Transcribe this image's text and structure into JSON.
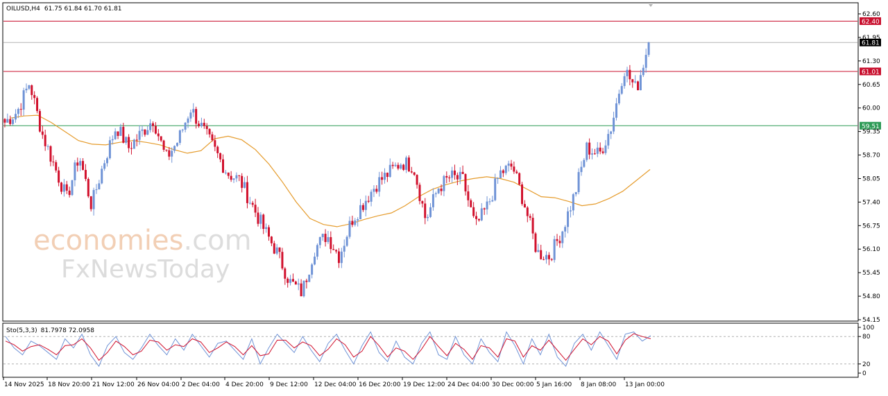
{
  "chart_data": [
    {
      "type": "candlestick",
      "title": "OILUSD,H4",
      "ohlc_header": "61.75 61.84 61.70 61.81",
      "last_price": 61.81,
      "ylim": [
        54.15,
        62.95
      ],
      "y_ticks": [
        "62.60",
        "61.95",
        "61.30",
        "60.65",
        "60.00",
        "59.35",
        "58.70",
        "58.05",
        "57.40",
        "56.75",
        "56.10",
        "55.45",
        "54.80",
        "54.15"
      ],
      "x_ticks": [
        "14 Nov 2025",
        "18 Nov 20:00",
        "21 Nov 12:00",
        "26 Nov 04:00",
        "2 Dec 04:00",
        "4 Dec 20:00",
        "9 Dec 12:00",
        "12 Dec 04:00",
        "16 Dec 20:00",
        "19 Dec 12:00",
        "24 Dec 04:00",
        "30 Dec 00:00",
        "5 Jan 16:00",
        "8 Jan 08:00",
        "13 Jan 00:00"
      ],
      "horizontal_levels": [
        {
          "label": "62.40",
          "value": 62.4,
          "color": "#c8102e"
        },
        {
          "label": "61.81",
          "value": 61.81,
          "color": "#b4b4b4"
        },
        {
          "label": "61.01",
          "value": 61.01,
          "color": "#c8102e"
        },
        {
          "label": "59.51",
          "value": 59.51,
          "color": "#2e9b57"
        }
      ],
      "up_color": "#6f93d6",
      "down_color": "#d1102c",
      "ma_color": "#e59b2b",
      "close_path": [
        59.6,
        59.9,
        60.7,
        59.3,
        58.4,
        57.5,
        58.7,
        57.3,
        58.5,
        59.5,
        58.9,
        59.3,
        59.7,
        58.6,
        59.1,
        60.0,
        59.4,
        58.8,
        58.2,
        58.0,
        57.3,
        56.6,
        56.0,
        55.2,
        54.9,
        56.1,
        56.5,
        55.9,
        56.9,
        57.4,
        57.9,
        58.2,
        58.5,
        58.4,
        56.9,
        57.8,
        58.1,
        58.0,
        56.7,
        57.3,
        58.2,
        58.4,
        57.3,
        56.0,
        55.9,
        56.6,
        57.6,
        58.9,
        58.7,
        59.5,
        61.1,
        60.5,
        61.8
      ],
      "ma_path": [
        59.72,
        59.78,
        59.8,
        59.6,
        59.35,
        59.1,
        59.0,
        58.98,
        59.05,
        59.1,
        59.05,
        58.98,
        58.85,
        58.75,
        58.82,
        59.15,
        59.22,
        59.12,
        58.85,
        58.45,
        57.95,
        57.4,
        56.95,
        56.78,
        56.72,
        56.8,
        56.92,
        57.02,
        57.1,
        57.3,
        57.55,
        57.75,
        57.88,
        57.98,
        58.05,
        58.1,
        58.05,
        57.95,
        57.75,
        57.55,
        57.52,
        57.42,
        57.3,
        57.35,
        57.5,
        57.7,
        58.0,
        58.3
      ],
      "ma_points_count": 48
    },
    {
      "type": "line",
      "title": "Sto(5,3,3)",
      "values_label": "81.7978 72.0958",
      "ylim": [
        0,
        100
      ],
      "y_ticks": [
        "100",
        "80",
        "20",
        "0"
      ],
      "levels": [
        80,
        20
      ],
      "series": [
        {
          "color": "#6f93d6",
          "values": [
            80,
            55,
            40,
            70,
            60,
            45,
            30,
            75,
            55,
            85,
            40,
            15,
            60,
            80,
            45,
            30,
            55,
            85,
            60,
            40,
            75,
            50,
            85,
            60,
            35,
            65,
            70,
            50,
            30,
            75,
            20,
            55,
            85,
            65,
            45,
            80,
            50,
            25,
            65,
            85,
            50,
            20,
            60,
            90,
            45,
            25,
            70,
            35,
            20,
            65,
            90,
            40,
            30,
            80,
            40,
            20,
            75,
            45,
            25,
            90,
            60,
            20,
            75,
            40,
            85,
            35,
            15,
            65,
            85,
            50,
            90,
            60,
            30,
            85,
            90,
            70,
            82
          ]
        },
        {
          "color": "#d1102c",
          "values": [
            70,
            62,
            48,
            58,
            62,
            52,
            40,
            60,
            62,
            75,
            55,
            28,
            45,
            70,
            58,
            40,
            48,
            72,
            68,
            50,
            62,
            58,
            75,
            68,
            45,
            55,
            68,
            58,
            40,
            60,
            38,
            42,
            72,
            72,
            55,
            68,
            60,
            38,
            52,
            75,
            62,
            35,
            48,
            80,
            60,
            35,
            55,
            48,
            30,
            52,
            80,
            58,
            38,
            65,
            52,
            30,
            60,
            55,
            35,
            75,
            70,
            35,
            60,
            50,
            72,
            50,
            28,
            52,
            75,
            62,
            80,
            70,
            42,
            72,
            86,
            80,
            75
          ]
        }
      ]
    }
  ],
  "watermark": {
    "line1a": "economies",
    "line1b": ".com",
    "line2": "FxNewsToday"
  }
}
